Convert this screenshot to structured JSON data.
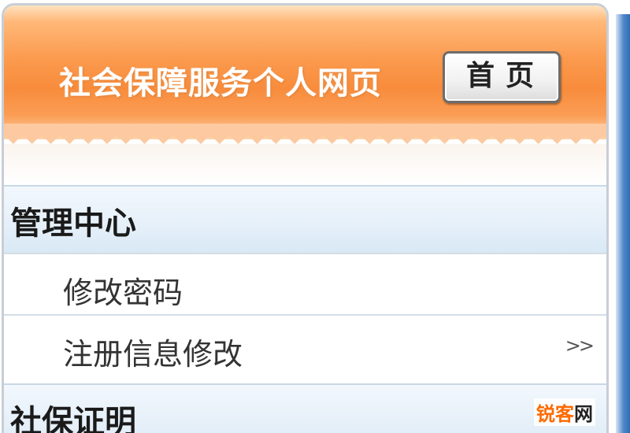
{
  "header": {
    "site_title": "社会保障服务个人网页",
    "home_label": "首页"
  },
  "menu": {
    "sections": [
      {
        "label": "管理中心",
        "items": [
          {
            "label": "修改密码",
            "arrow": ""
          },
          {
            "label": "注册信息修改",
            "arrow": ">>"
          }
        ]
      },
      {
        "label": "社保证明",
        "items": []
      }
    ]
  },
  "watermark": {
    "brand": "锐客",
    "tail": "网"
  },
  "colors": {
    "header_orange": "#f88c3c",
    "section_blue": "#e6f0f9",
    "edge_blue": "#2f6db6",
    "watermark_orange": "#ff6a00"
  }
}
